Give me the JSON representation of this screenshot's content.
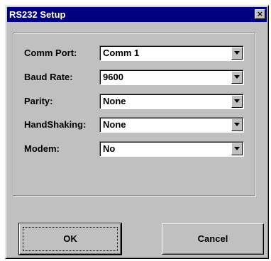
{
  "dialog": {
    "title": "RS232 Setup",
    "close_glyph": "×"
  },
  "fields": [
    {
      "label": "Comm Port:",
      "value": "Comm 1"
    },
    {
      "label": "Baud Rate:",
      "value": "9600"
    },
    {
      "label": "Parity:",
      "value": "None"
    },
    {
      "label": "HandShaking:",
      "value": "None"
    },
    {
      "label": "Modem:",
      "value": "No"
    }
  ],
  "buttons": {
    "ok_label": "OK",
    "cancel_label": "Cancel"
  },
  "colors": {
    "titlebar": "#000080",
    "face": "#c0c0c0"
  },
  "icons": {
    "dropdown": "chevron-down-icon",
    "close": "close-icon"
  }
}
